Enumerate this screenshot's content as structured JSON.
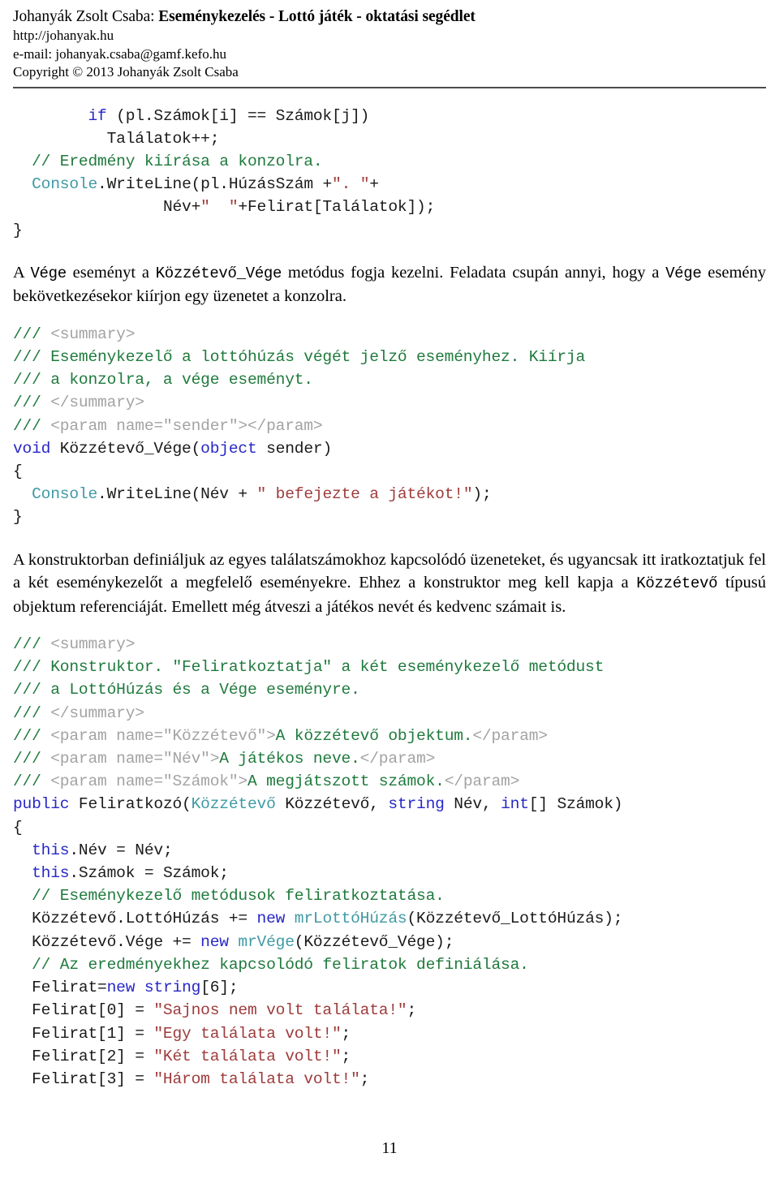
{
  "header": {
    "author": "Johanyák Zsolt Csaba: ",
    "title": "Eseménykezelés - Lottó játék - oktatási segédlet",
    "website": "http://johanyak.hu",
    "email": "e-mail: johanyak.csaba@gamf.kefo.hu",
    "copyright": "Copyright © 2013 Johanyák Zsolt Csaba"
  },
  "colors": {
    "keyword": "#2727c8",
    "type": "#3f9aa4",
    "comment": "#1f7a3d",
    "xml_tag": "#a3a3a3",
    "string": "#9e3b3b",
    "plain": "#1a1a1a",
    "rule": "#4b4b4b"
  },
  "code_block_1": {
    "lines": [
      [
        {
          "t": "        ",
          "c": "pln"
        },
        {
          "t": "if",
          "c": "kw"
        },
        {
          "t": " (pl.Számok[i] == Számok[j])",
          "c": "pln"
        }
      ],
      [
        {
          "t": "          Találatok++;",
          "c": "pln"
        }
      ],
      [
        {
          "t": "  ",
          "c": "pln"
        },
        {
          "t": "// Eredmény kiírása a konzolra.",
          "c": "cmt"
        }
      ],
      [
        {
          "t": "  ",
          "c": "pln"
        },
        {
          "t": "Console",
          "c": "type"
        },
        {
          "t": ".WriteLine(pl.HúzásSzám +",
          "c": "pln"
        },
        {
          "t": "\". \"",
          "c": "str"
        },
        {
          "t": "+",
          "c": "pln"
        }
      ],
      [
        {
          "t": "                ",
          "c": "pln"
        },
        {
          "t": "Név+",
          "c": "pln"
        },
        {
          "t": "\"  \"",
          "c": "str"
        },
        {
          "t": "+Felirat[Találatok]);",
          "c": "pln"
        }
      ],
      [
        {
          "t": "}",
          "c": "pln"
        }
      ]
    ]
  },
  "paragraph_1": {
    "runs": [
      {
        "t": "A ",
        "m": false
      },
      {
        "t": "Vége",
        "m": true
      },
      {
        "t": " eseményt a ",
        "m": false
      },
      {
        "t": "Közzétevő_Vége",
        "m": true
      },
      {
        "t": " metódus fogja kezelni. Feladata csupán annyi, hogy a ",
        "m": false
      },
      {
        "t": "Vége",
        "m": true
      },
      {
        "t": " esemény bekövetkezésekor kiírjon egy üzenetet a konzolra.",
        "m": false
      }
    ]
  },
  "code_block_2": {
    "lines": [
      [
        {
          "t": "/// ",
          "c": "cmt"
        },
        {
          "t": "<summary>",
          "c": "xmltag"
        }
      ],
      [
        {
          "t": "/// ",
          "c": "cmt"
        },
        {
          "t": "Eseménykezelő a lottóhúzás végét jelző eseményhez. Kiírja",
          "c": "cmt"
        }
      ],
      [
        {
          "t": "/// ",
          "c": "cmt"
        },
        {
          "t": "a konzolra, a vége eseményt.",
          "c": "cmt"
        }
      ],
      [
        {
          "t": "/// ",
          "c": "cmt"
        },
        {
          "t": "</summary>",
          "c": "xmltag"
        }
      ],
      [
        {
          "t": "/// ",
          "c": "cmt"
        },
        {
          "t": "<param name=\"sender\"></param>",
          "c": "xmltag"
        }
      ],
      [
        {
          "t": "void",
          "c": "kw"
        },
        {
          "t": " Közzétevő_Vége(",
          "c": "pln"
        },
        {
          "t": "object",
          "c": "kw"
        },
        {
          "t": " sender)",
          "c": "pln"
        }
      ],
      [
        {
          "t": "{",
          "c": "pln"
        }
      ],
      [
        {
          "t": "  ",
          "c": "pln"
        },
        {
          "t": "Console",
          "c": "type"
        },
        {
          "t": ".WriteLine(Név + ",
          "c": "pln"
        },
        {
          "t": "\" befejezte a játékot!\"",
          "c": "str"
        },
        {
          "t": ");",
          "c": "pln"
        }
      ],
      [
        {
          "t": "}",
          "c": "pln"
        }
      ]
    ]
  },
  "paragraph_2": {
    "runs": [
      {
        "t": "A konstruktorban definiáljuk az egyes találatszámokhoz kapcsolódó üzeneteket, és ugyancsak itt iratkoztatjuk fel a két eseménykezelőt a megfelelő eseményekre. Ehhez a konstruktor meg kell kapja a ",
        "m": false
      },
      {
        "t": "Közzétevő",
        "m": true
      },
      {
        "t": " típusú objektum referenciáját. Emellett még átveszi a játékos nevét és kedvenc számait is.",
        "m": false
      }
    ]
  },
  "code_block_3": {
    "lines": [
      [
        {
          "t": "/// ",
          "c": "cmt"
        },
        {
          "t": "<summary>",
          "c": "xmltag"
        }
      ],
      [
        {
          "t": "/// ",
          "c": "cmt"
        },
        {
          "t": "Konstruktor. \"Feliratkoztatja\" a két eseménykezelő metódust",
          "c": "cmt"
        }
      ],
      [
        {
          "t": "/// ",
          "c": "cmt"
        },
        {
          "t": "a LottóHúzás és a Vége eseményre.",
          "c": "cmt"
        }
      ],
      [
        {
          "t": "/// ",
          "c": "cmt"
        },
        {
          "t": "</summary>",
          "c": "xmltag"
        }
      ],
      [
        {
          "t": "/// ",
          "c": "cmt"
        },
        {
          "t": "<param name=\"Közzétevő\">",
          "c": "xmltag"
        },
        {
          "t": "A közzétevő objektum.",
          "c": "cmt"
        },
        {
          "t": "</param>",
          "c": "xmltag"
        }
      ],
      [
        {
          "t": "/// ",
          "c": "cmt"
        },
        {
          "t": "<param name=\"Név\">",
          "c": "xmltag"
        },
        {
          "t": "A játékos neve.",
          "c": "cmt"
        },
        {
          "t": "</param>",
          "c": "xmltag"
        }
      ],
      [
        {
          "t": "/// ",
          "c": "cmt"
        },
        {
          "t": "<param name=\"Számok\">",
          "c": "xmltag"
        },
        {
          "t": "A megjátszott számok.",
          "c": "cmt"
        },
        {
          "t": "</param>",
          "c": "xmltag"
        }
      ],
      [
        {
          "t": "public",
          "c": "kw"
        },
        {
          "t": " Feliratkozó(",
          "c": "pln"
        },
        {
          "t": "Közzétevő",
          "c": "type"
        },
        {
          "t": " Közzétevő, ",
          "c": "pln"
        },
        {
          "t": "string",
          "c": "kw"
        },
        {
          "t": " Név, ",
          "c": "pln"
        },
        {
          "t": "int",
          "c": "kw"
        },
        {
          "t": "[] Számok)",
          "c": "pln"
        }
      ],
      [
        {
          "t": "{",
          "c": "pln"
        }
      ],
      [
        {
          "t": "  ",
          "c": "pln"
        },
        {
          "t": "this",
          "c": "kw"
        },
        {
          "t": ".Név = Név;",
          "c": "pln"
        }
      ],
      [
        {
          "t": "  ",
          "c": "pln"
        },
        {
          "t": "this",
          "c": "kw"
        },
        {
          "t": ".Számok = Számok;",
          "c": "pln"
        }
      ],
      [
        {
          "t": "  ",
          "c": "pln"
        },
        {
          "t": "// Eseménykezelő metódusok feliratkoztatása.",
          "c": "cmt"
        }
      ],
      [
        {
          "t": "  Közzétevő.LottóHúzás += ",
          "c": "pln"
        },
        {
          "t": "new",
          "c": "kw"
        },
        {
          "t": " ",
          "c": "pln"
        },
        {
          "t": "mrLottóHúzás",
          "c": "type"
        },
        {
          "t": "(Közzétevő_LottóHúzás);",
          "c": "pln"
        }
      ],
      [
        {
          "t": "  Közzétevő.Vége += ",
          "c": "pln"
        },
        {
          "t": "new",
          "c": "kw"
        },
        {
          "t": " ",
          "c": "pln"
        },
        {
          "t": "mrVége",
          "c": "type"
        },
        {
          "t": "(Közzétevő_Vége);",
          "c": "pln"
        }
      ],
      [
        {
          "t": "  ",
          "c": "pln"
        },
        {
          "t": "// Az eredményekhez kapcsolódó feliratok definiálása.",
          "c": "cmt"
        }
      ],
      [
        {
          "t": "  Felirat=",
          "c": "pln"
        },
        {
          "t": "new",
          "c": "kw"
        },
        {
          "t": " ",
          "c": "pln"
        },
        {
          "t": "string",
          "c": "kw"
        },
        {
          "t": "[6];",
          "c": "pln"
        }
      ],
      [
        {
          "t": "  Felirat[0] = ",
          "c": "pln"
        },
        {
          "t": "\"Sajnos nem volt találata!\"",
          "c": "str"
        },
        {
          "t": ";",
          "c": "pln"
        }
      ],
      [
        {
          "t": "  Felirat[1] = ",
          "c": "pln"
        },
        {
          "t": "\"Egy találata volt!\"",
          "c": "str"
        },
        {
          "t": ";",
          "c": "pln"
        }
      ],
      [
        {
          "t": "  Felirat[2] = ",
          "c": "pln"
        },
        {
          "t": "\"Két találata volt!\"",
          "c": "str"
        },
        {
          "t": ";",
          "c": "pln"
        }
      ],
      [
        {
          "t": "  Felirat[3] = ",
          "c": "pln"
        },
        {
          "t": "\"Három találata volt!\"",
          "c": "str"
        },
        {
          "t": ";",
          "c": "pln"
        }
      ]
    ]
  },
  "footer": {
    "page_number": "11"
  }
}
